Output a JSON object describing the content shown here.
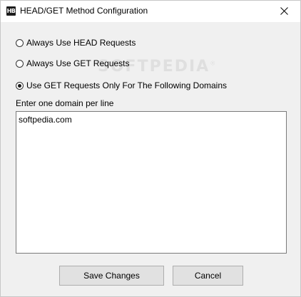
{
  "window": {
    "title": "HEAD/GET Method Configuration",
    "icon_text": "HB",
    "icon": "app-icon",
    "close_icon": "close-icon"
  },
  "options": [
    {
      "label": "Always Use HEAD Requests",
      "checked": false
    },
    {
      "label": "Always Use GET Requests",
      "checked": false
    },
    {
      "label": "Use GET Requests Only For The Following Domains",
      "checked": true
    }
  ],
  "domains": {
    "label": "Enter one domain per line",
    "value": "softpedia.com"
  },
  "buttons": {
    "save_label": "Save Changes",
    "cancel_label": "Cancel"
  },
  "watermark": {
    "text": "SOFTPEDIA",
    "mark": "®"
  },
  "colors": {
    "window_bg": "#f0f0f0",
    "titlebar_bg": "#ffffff",
    "button_bg": "#e1e1e1",
    "button_border": "#adadad"
  }
}
